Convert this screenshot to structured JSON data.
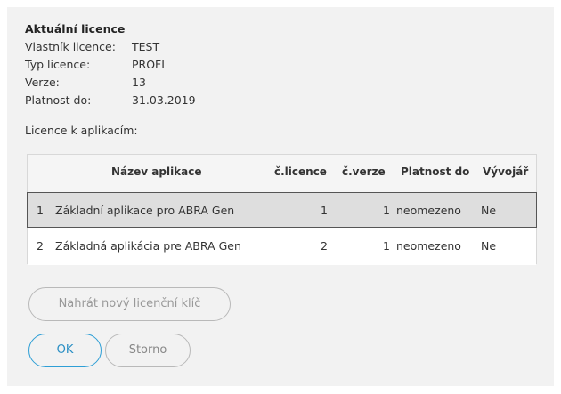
{
  "license": {
    "title": "Aktuální licence",
    "fields": [
      {
        "label": "Vlastník licence:",
        "value": "TEST"
      },
      {
        "label": "Typ licence:",
        "value": "PROFI"
      },
      {
        "label": "Verze:",
        "value": "13"
      },
      {
        "label": "Platnost do:",
        "value": "31.03.2019"
      }
    ]
  },
  "apps": {
    "label": "Licence k aplikacím:",
    "columns": [
      "Název aplikace",
      "č.licence",
      "č.verze",
      "Platnost do",
      "Vývojář"
    ],
    "rows": [
      {
        "num": "1",
        "name": "Základní aplikace pro ABRA Gen",
        "licence": "1",
        "version": "1",
        "validity": "neomezeno",
        "developer": "Ne"
      },
      {
        "num": "2",
        "name": "Základná aplikácia pre ABRA Gen",
        "licence": "2",
        "version": "1",
        "validity": "neomezeno",
        "developer": "Ne"
      }
    ]
  },
  "buttons": {
    "upload": "Nahrát nový licenční klíč",
    "ok": "OK",
    "cancel": "Storno"
  },
  "colors": {
    "background": "#f2f2f2",
    "selected_row": "#dedede",
    "accent": "#2e9fd6"
  }
}
